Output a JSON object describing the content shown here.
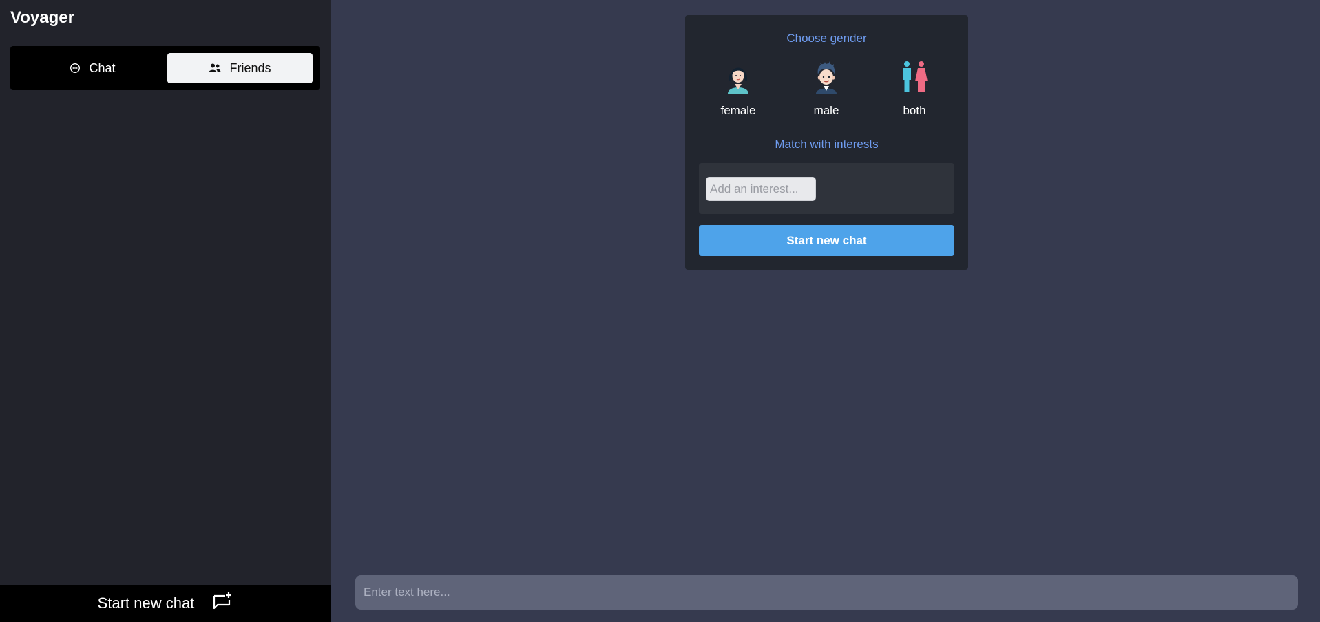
{
  "app": {
    "title": "Voyager"
  },
  "sidebar": {
    "tabs": [
      {
        "label": "Chat",
        "icon": "chat-bubble-icon",
        "active": false
      },
      {
        "label": "Friends",
        "icon": "users-icon",
        "active": true
      }
    ],
    "new_chat": {
      "label": "Start new chat",
      "icon": "add-chat-icon"
    }
  },
  "card": {
    "gender_title": "Choose gender",
    "genders": [
      {
        "label": "female",
        "icon": "female-avatar-icon"
      },
      {
        "label": "male",
        "icon": "male-avatar-icon"
      },
      {
        "label": "both",
        "icon": "male-female-icon"
      }
    ],
    "interests_title": "Match with interests",
    "interest_placeholder": "Add an interest...",
    "start_button": "Start new chat"
  },
  "composer": {
    "placeholder": "Enter text here..."
  },
  "colors": {
    "accent_blue": "#4ea3ea",
    "title_blue": "#6f9cf0",
    "sidebar_bg": "#22232b",
    "main_bg": "#363a4f"
  }
}
